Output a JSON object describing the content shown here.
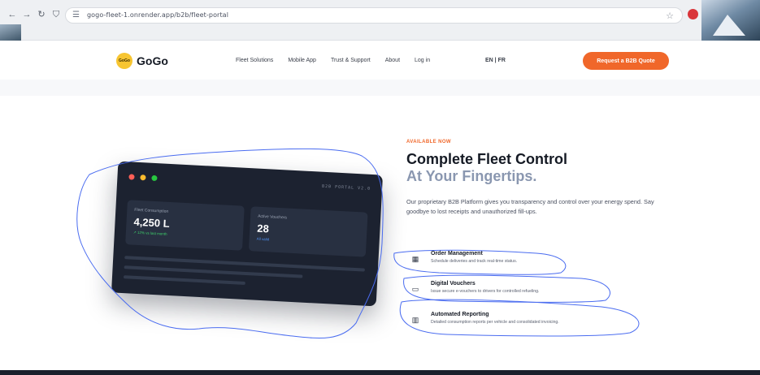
{
  "browser": {
    "url": "gogo-fleet-1.onrender.app/b2b/fleet-portal",
    "back_icon": "arrow-left-icon",
    "forward_icon": "arrow-right-icon",
    "reload_icon": "reload-icon",
    "bookmark_icon": "star-icon"
  },
  "nav": {
    "logo_badge": "GoGo",
    "logo_text": "GoGo",
    "links": [
      "Fleet Solutions",
      "Mobile App",
      "Trust & Support",
      "About",
      "Log in"
    ],
    "lang": "EN | FR",
    "cta": "Request a B2B Quote"
  },
  "dashboard": {
    "tag": "B2B PORTAL V2.0",
    "metric1": {
      "label": "Fleet Consumption",
      "value": "4,250 L",
      "sub": "↗ 12% vs last month"
    },
    "metric2": {
      "label": "Active Vouchers",
      "value": "28",
      "sub": "All valid"
    }
  },
  "hero": {
    "eyebrow": "AVAILABLE NOW",
    "title": "Complete Fleet Control",
    "title_accent": "At Your Fingertips.",
    "description": "Our proprietary B2B Platform gives you transparency and control over your energy spend. Say goodbye to lost receipts and unauthorized fill-ups."
  },
  "features": [
    {
      "title": "Order Management",
      "desc": "Schedule deliveries and track real-time status.",
      "icon": "calendar-icon"
    },
    {
      "title": "Digital Vouchers",
      "desc": "Issue secure e-vouchers to drivers for controlled refueling.",
      "icon": "card-icon"
    },
    {
      "title": "Automated Reporting",
      "desc": "Detailed consumption reports per vehicle and consolidated invoicing.",
      "icon": "chart-icon"
    }
  ],
  "colors": {
    "accent": "#f0672a",
    "brand_yellow": "#f7c531",
    "card_bg": "#1c2230",
    "positive": "#3fcf6b",
    "info": "#4f8ff0"
  }
}
